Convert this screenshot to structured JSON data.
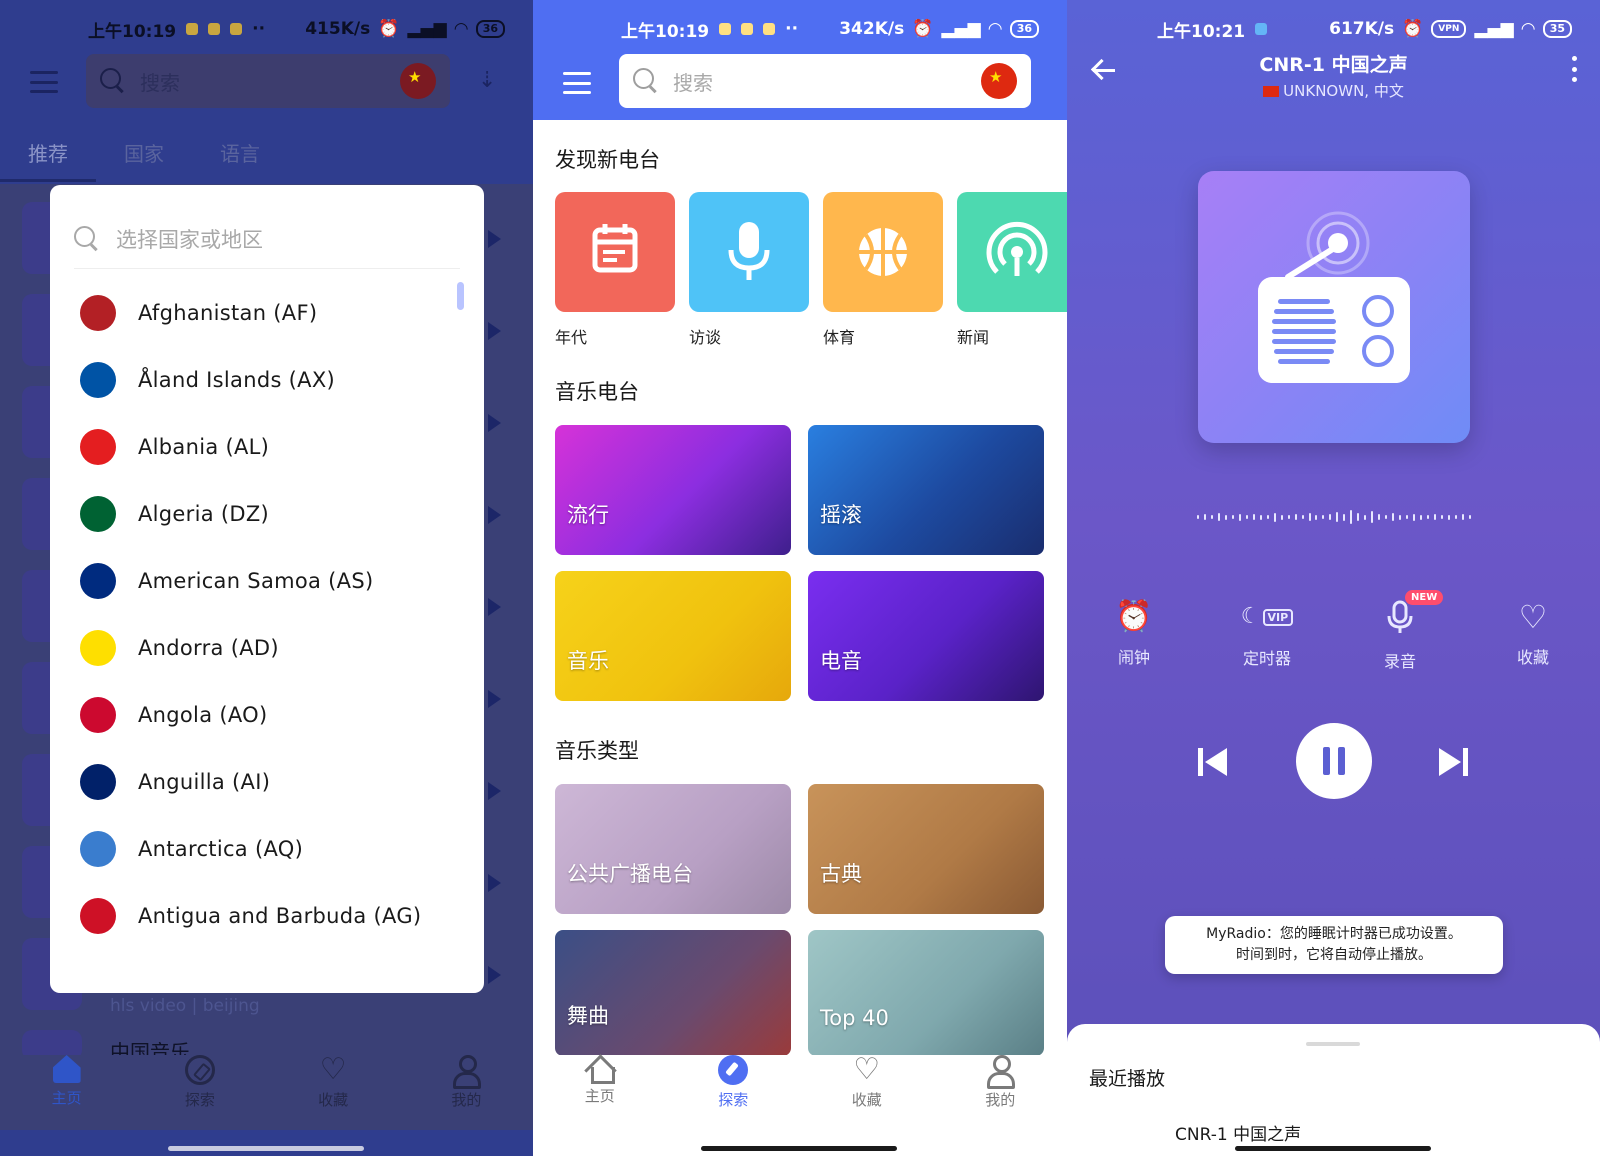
{
  "screen1": {
    "status": {
      "time": "上午10:19",
      "dots": "··",
      "speed": "415K/s",
      "battery": "36"
    },
    "search_placeholder": "搜索",
    "tabs": [
      {
        "label": "推荐",
        "active": true
      },
      {
        "label": "国家",
        "active": false
      },
      {
        "label": "语言",
        "active": false
      }
    ],
    "background_rows": {
      "subtitle": "hls video | beijing",
      "title": "中国音乐"
    },
    "dialog": {
      "search_placeholder": "选择国家或地区",
      "countries": [
        {
          "name": "Afghanistan (AF)",
          "flag_color": "#b32025"
        },
        {
          "name": "Åland Islands (AX)",
          "flag_color": "#0053a5"
        },
        {
          "name": "Albania (AL)",
          "flag_color": "#e41e20"
        },
        {
          "name": "Algeria (DZ)",
          "flag_color": "#006233"
        },
        {
          "name": "American Samoa (AS)",
          "flag_color": "#002b7f"
        },
        {
          "name": "Andorra (AD)",
          "flag_color": "#fedf00"
        },
        {
          "name": "Angola (AO)",
          "flag_color": "#cc092f"
        },
        {
          "name": "Anguilla (AI)",
          "flag_color": "#012169"
        },
        {
          "name": "Antarctica (AQ)",
          "flag_color": "#3a7dce"
        },
        {
          "name": "Antigua and Barbuda (AG)",
          "flag_color": "#ce1126"
        }
      ]
    },
    "nav": [
      {
        "label": "主页",
        "active": true
      },
      {
        "label": "探索",
        "active": false
      },
      {
        "label": "收藏",
        "active": false
      },
      {
        "label": "我的",
        "active": false
      }
    ]
  },
  "screen2": {
    "status": {
      "time": "上午10:19",
      "dots": "··",
      "speed": "342K/s",
      "battery": "36"
    },
    "search_placeholder": "搜索",
    "discover_title": "发现新电台",
    "discover_tiles": [
      {
        "label": "年代",
        "color": "#f2675a",
        "icon": "calendar-icon"
      },
      {
        "label": "访谈",
        "color": "#4fc3f7",
        "icon": "microphone-icon"
      },
      {
        "label": "体育",
        "color": "#ffb74d",
        "icon": "basketball-icon"
      },
      {
        "label": "新闻",
        "color": "#4dd9b0",
        "icon": "broadcast-icon"
      }
    ],
    "music_radio_title": "音乐电台",
    "music_radio_cards": [
      {
        "label": "流行"
      },
      {
        "label": "摇滚"
      },
      {
        "label": "音乐"
      },
      {
        "label": "电音"
      }
    ],
    "genre_title": "音乐类型",
    "genre_cards": [
      {
        "label": "公共广播电台"
      },
      {
        "label": "古典"
      },
      {
        "label": "舞曲"
      },
      {
        "label": "Top 40"
      }
    ],
    "nav": [
      {
        "label": "主页",
        "active": false
      },
      {
        "label": "探索",
        "active": true
      },
      {
        "label": "收藏",
        "active": false
      },
      {
        "label": "我的",
        "active": false
      }
    ],
    "accent": "#4f6ef2"
  },
  "screen3": {
    "status": {
      "time": "上午10:21",
      "speed": "617K/s",
      "vpn": "VPN",
      "battery": "35"
    },
    "title": "CNR-1 中国之声",
    "subtitle": "UNKNOWN, 中文",
    "controls": [
      {
        "label": "闹钟",
        "icon": "alarm-icon"
      },
      {
        "label": "定时器",
        "icon": "sleep-timer-vip-icon",
        "badge": "VIP"
      },
      {
        "label": "录音",
        "icon": "record-mic-icon",
        "badge": "NEW"
      },
      {
        "label": "收藏",
        "icon": "heart-icon"
      }
    ],
    "toast": {
      "line1": "MyRadio：您的睡眠计时器已成功设置。",
      "line2": "时间到时，它将自动停止播放。"
    },
    "recent_title": "最近播放",
    "recent_item": "CNR-1 中国之声"
  }
}
